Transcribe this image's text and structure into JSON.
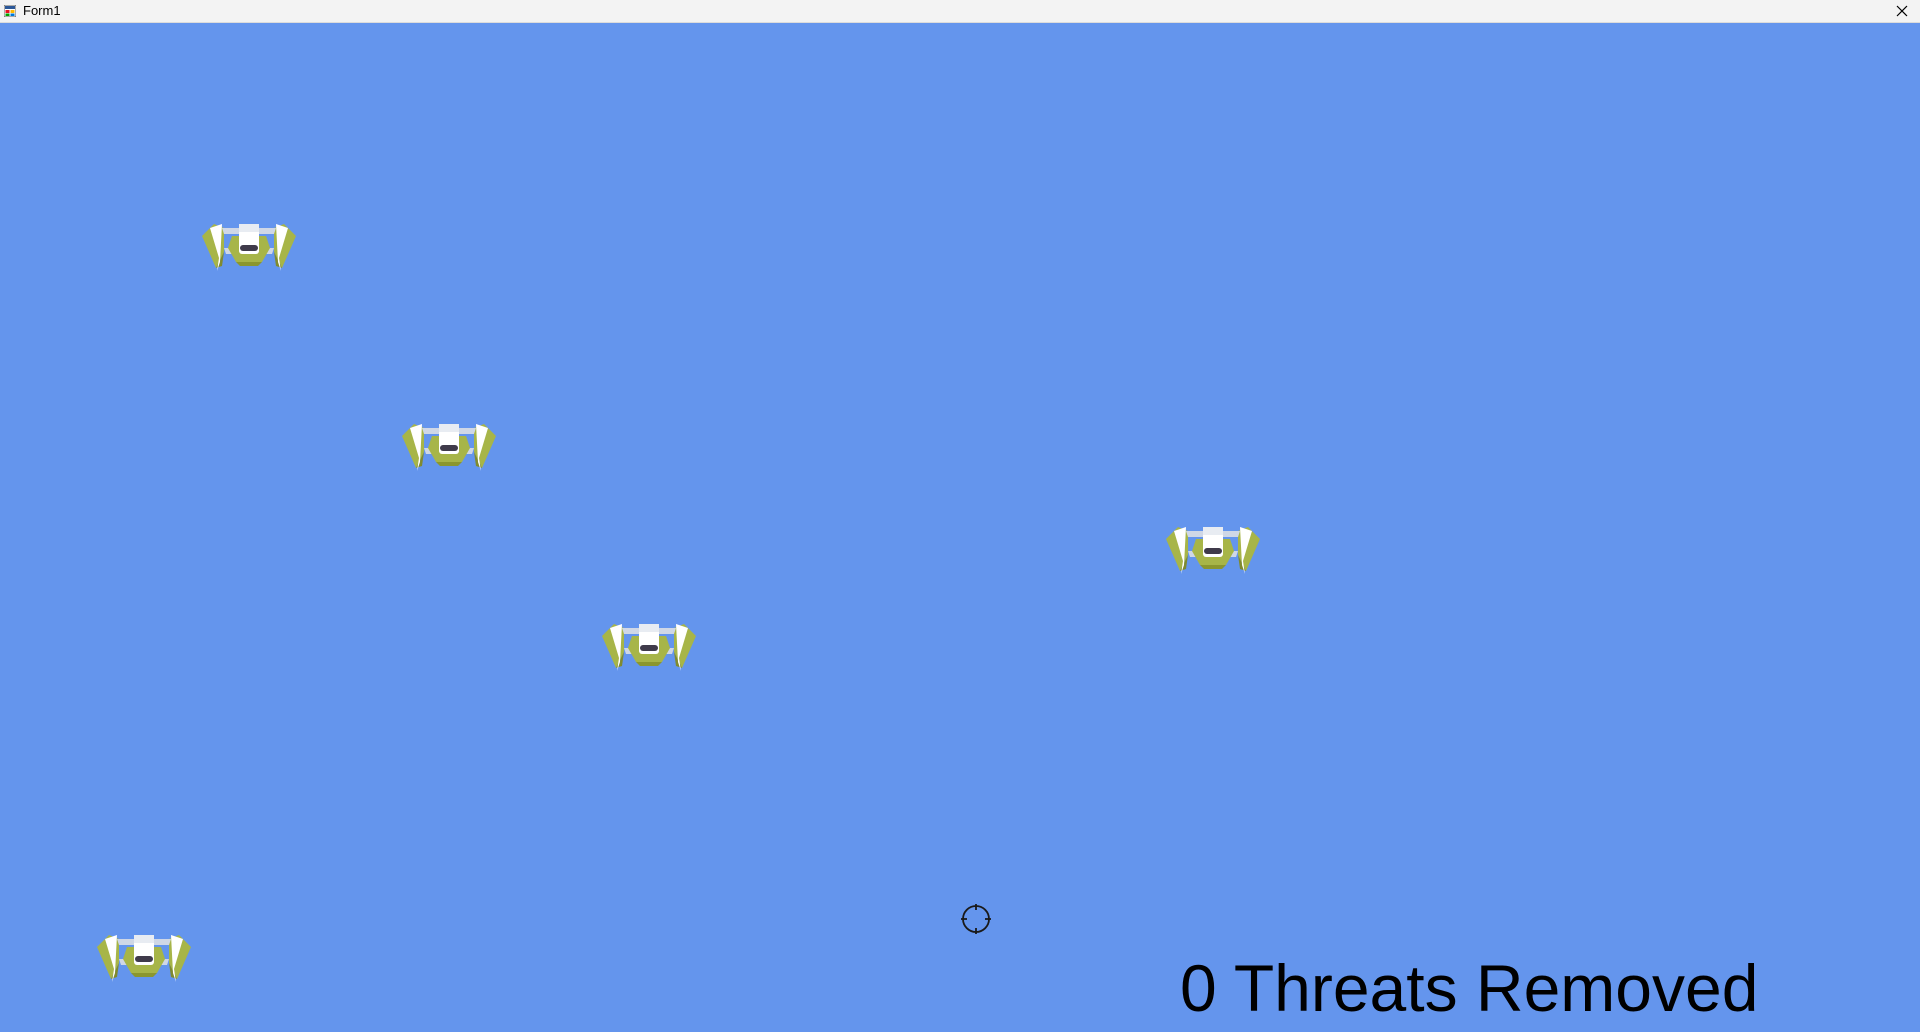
{
  "window": {
    "title": "Form1",
    "app_icon": "windows-form-icon",
    "close_icon": "close-icon",
    "background_color": "#6495ed"
  },
  "game": {
    "enemy_icon": "spaceship-icon",
    "enemy_count": 5,
    "crosshair_icon": "crosshair-icon",
    "score": {
      "value": "0",
      "label": "Threats Removed",
      "text": "0 Threats Removed"
    }
  }
}
